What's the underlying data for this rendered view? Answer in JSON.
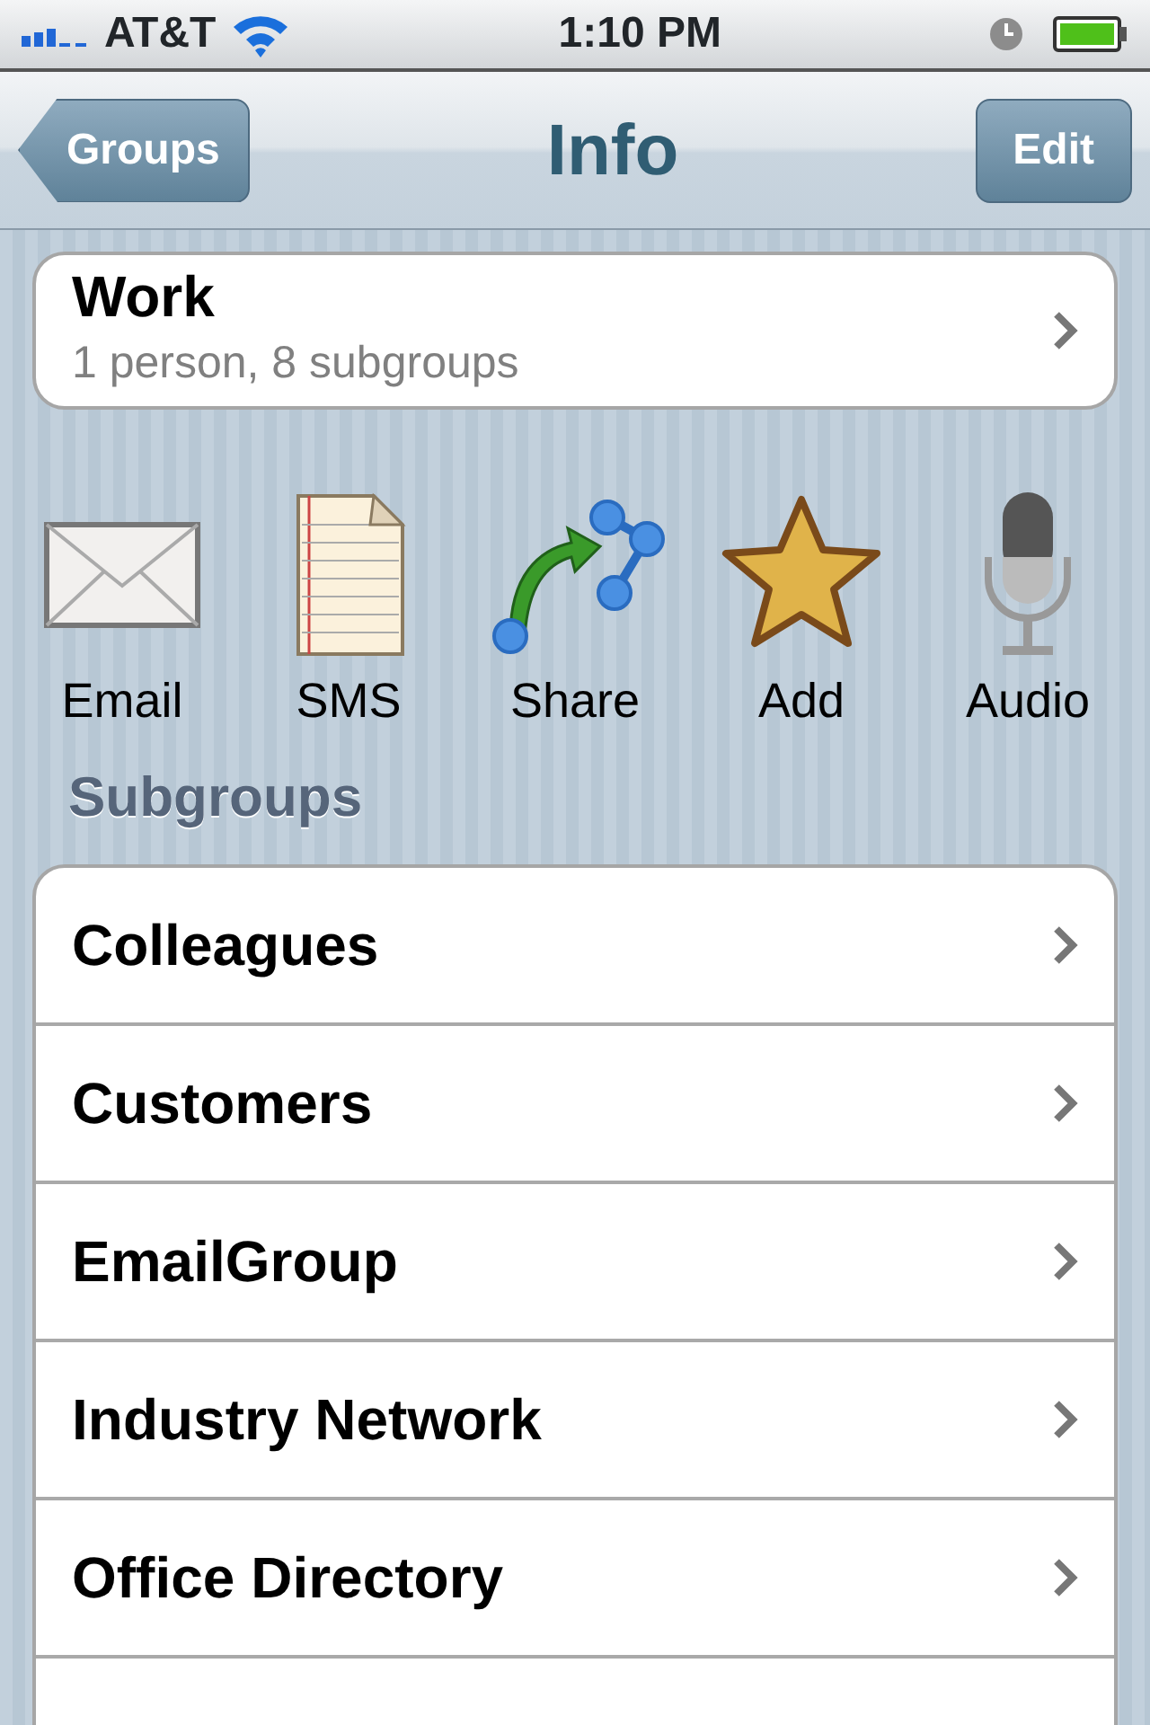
{
  "status_bar": {
    "carrier": "AT&T",
    "time": "1:10 PM"
  },
  "nav_bar": {
    "back_button": "Groups",
    "title": "Info",
    "edit_button": "Edit"
  },
  "group": {
    "name": "Work",
    "summary": "1 person, 8 subgroups"
  },
  "actions": [
    {
      "kind": "email",
      "label": "Email"
    },
    {
      "kind": "sms",
      "label": "SMS"
    },
    {
      "kind": "share",
      "label": "Share"
    },
    {
      "kind": "add",
      "label": "Add"
    },
    {
      "kind": "audio",
      "label": "Audio"
    }
  ],
  "subgroups_header": "Subgroups",
  "subgroups": [
    {
      "name": "Colleagues"
    },
    {
      "name": "Customers"
    },
    {
      "name": "EmailGroup"
    },
    {
      "name": "Industry Network"
    },
    {
      "name": "Office Directory"
    }
  ]
}
